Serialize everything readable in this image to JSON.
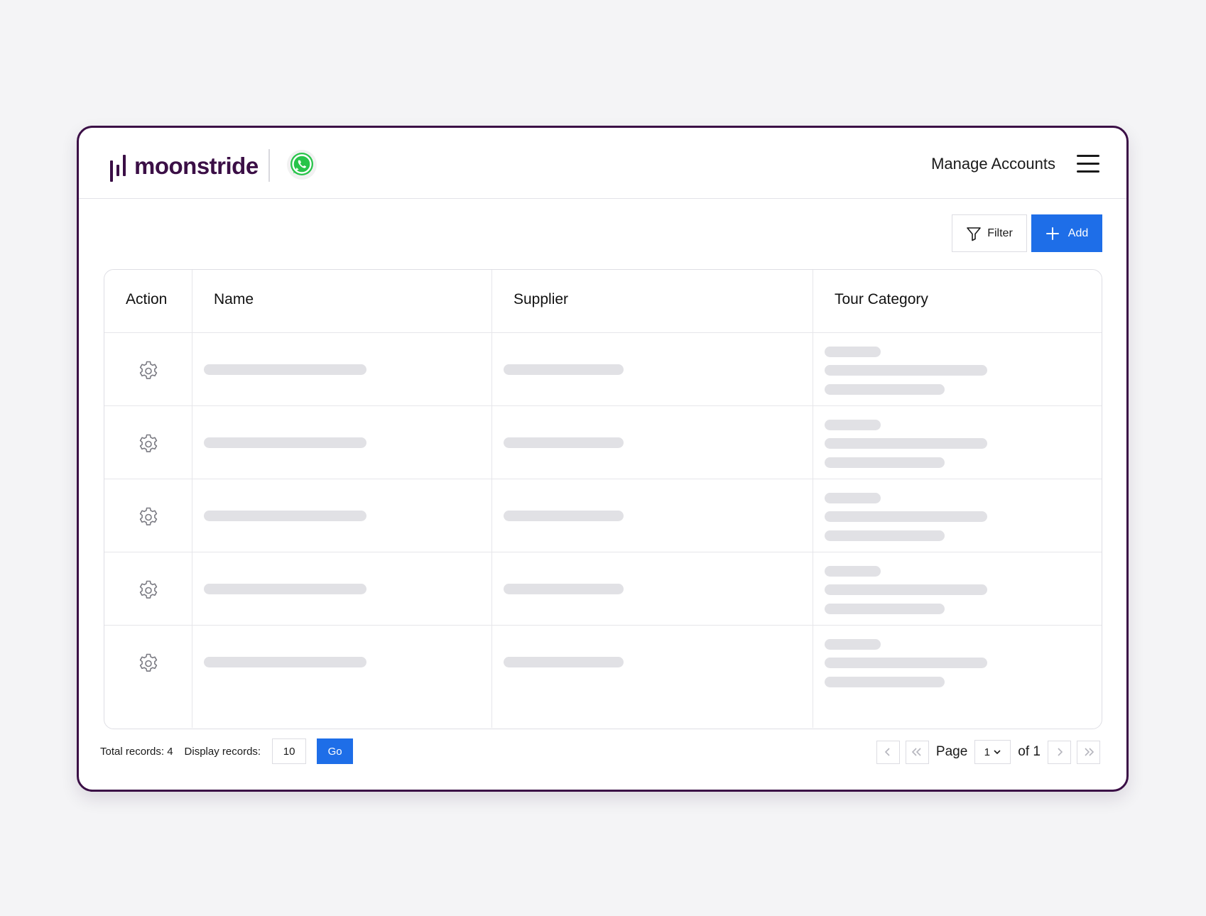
{
  "app": {
    "brand": "moonstride",
    "header_link": "Manage Accounts"
  },
  "toolbar": {
    "filter_label": "Filter",
    "add_label": "Add"
  },
  "table": {
    "columns": [
      "Action",
      "Name",
      "Supplier",
      "Tour Category"
    ],
    "row_count": 5,
    "action_icon": "gear-icon"
  },
  "footer": {
    "total_records": "Total records: 4",
    "display_label": "Display records:",
    "display_value": "10",
    "go_label": "Go"
  },
  "pagination": {
    "page_label": "Page",
    "current_page": "1",
    "of_label": "of 1"
  },
  "colors": {
    "brand": "#3b0f46",
    "primary": "#1e6ee8",
    "skeleton": "#e1e1e5"
  }
}
